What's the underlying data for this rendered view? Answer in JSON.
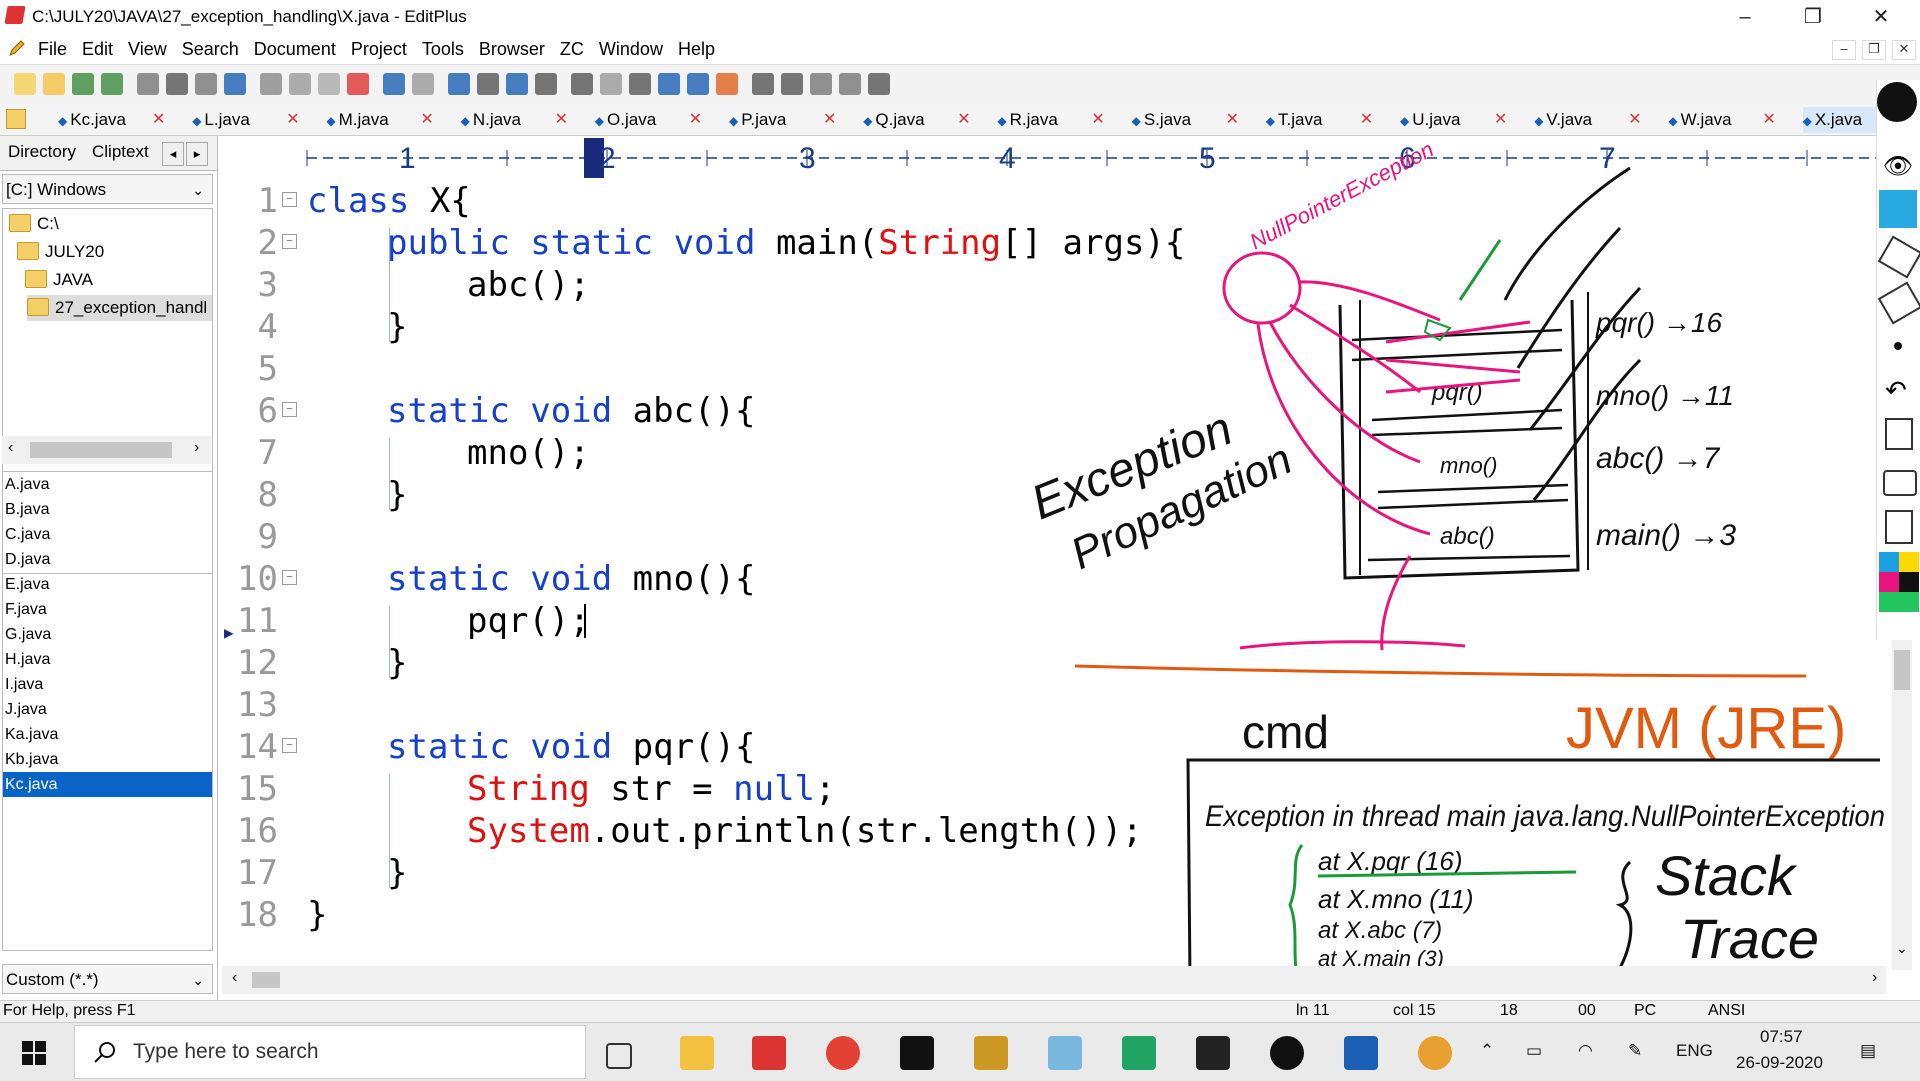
{
  "window": {
    "title": "C:\\JULY20\\JAVA\\27_exception_handling\\X.java - EditPlus",
    "controls": [
      "–",
      "❐",
      "✕"
    ]
  },
  "menubar": {
    "items": [
      "File",
      "Edit",
      "View",
      "Search",
      "Document",
      "Project",
      "Tools",
      "Browser",
      "ZC",
      "Window",
      "Help"
    ]
  },
  "tabs": [
    "Kc.java",
    "L.java",
    "M.java",
    "N.java",
    "O.java",
    "P.java",
    "Q.java",
    "R.java",
    "S.java",
    "T.java",
    "U.java",
    "V.java",
    "W.java",
    "X.java"
  ],
  "active_tab": "X.java",
  "left_panel": {
    "tabs": [
      "Directory",
      "Cliptext"
    ],
    "drive": "[C:] Windows",
    "tree": [
      "C:\\",
      "JULY20",
      "JAVA",
      "27_exception_handl"
    ],
    "files": [
      "A.java",
      "B.java",
      "C.java",
      "D.java",
      "E.java",
      "F.java",
      "G.java",
      "H.java",
      "I.java",
      "J.java",
      "Ka.java",
      "Kb.java",
      "Kc.java"
    ],
    "selected_file": "Kc.java",
    "filter": "Custom (*.*)"
  },
  "ruler": {
    "numbers": [
      "1",
      "2",
      "3",
      "4",
      "5",
      "6",
      "7"
    ]
  },
  "code": {
    "current_line": 11,
    "lines": [
      {
        "n": "1",
        "indent": 0,
        "tokens": [
          {
            "t": "class",
            "c": "kw"
          },
          {
            "t": " X{",
            "c": ""
          }
        ],
        "fold": true
      },
      {
        "n": "2",
        "indent": 1,
        "tokens": [
          {
            "t": "public static void",
            "c": "kw"
          },
          {
            "t": " main(",
            "c": ""
          },
          {
            "t": "String",
            "c": "red"
          },
          {
            "t": "[] args){",
            "c": ""
          }
        ],
        "fold": true
      },
      {
        "n": "3",
        "indent": 2,
        "tokens": [
          {
            "t": "abc();",
            "c": ""
          }
        ]
      },
      {
        "n": "4",
        "indent": 1,
        "tokens": [
          {
            "t": "}",
            "c": ""
          }
        ]
      },
      {
        "n": "5",
        "indent": 0,
        "tokens": []
      },
      {
        "n": "6",
        "indent": 1,
        "tokens": [
          {
            "t": "static void",
            "c": "kw"
          },
          {
            "t": " abc(){",
            "c": ""
          }
        ],
        "fold": true
      },
      {
        "n": "7",
        "indent": 2,
        "tokens": [
          {
            "t": "mno();",
            "c": ""
          }
        ]
      },
      {
        "n": "8",
        "indent": 1,
        "tokens": [
          {
            "t": "}",
            "c": ""
          }
        ]
      },
      {
        "n": "9",
        "indent": 0,
        "tokens": []
      },
      {
        "n": "10",
        "indent": 1,
        "tokens": [
          {
            "t": "static void",
            "c": "kw"
          },
          {
            "t": " mno(){",
            "c": ""
          }
        ],
        "fold": true
      },
      {
        "n": "11",
        "indent": 2,
        "tokens": [
          {
            "t": "pqr();",
            "c": ""
          }
        ]
      },
      {
        "n": "12",
        "indent": 1,
        "tokens": [
          {
            "t": "}",
            "c": ""
          }
        ]
      },
      {
        "n": "13",
        "indent": 0,
        "tokens": []
      },
      {
        "n": "14",
        "indent": 1,
        "tokens": [
          {
            "t": "static void",
            "c": "kw"
          },
          {
            "t": " pqr(){",
            "c": ""
          }
        ],
        "fold": true
      },
      {
        "n": "15",
        "indent": 2,
        "tokens": [
          {
            "t": "String",
            "c": "red"
          },
          {
            "t": " str = ",
            "c": ""
          },
          {
            "t": "null",
            "c": "kw"
          },
          {
            "t": ";",
            "c": ""
          }
        ]
      },
      {
        "n": "16",
        "indent": 2,
        "tokens": [
          {
            "t": "System",
            "c": "red"
          },
          {
            "t": ".out.println(str.length());",
            "c": ""
          }
        ]
      },
      {
        "n": "17",
        "indent": 1,
        "tokens": [
          {
            "t": "}",
            "c": ""
          }
        ]
      },
      {
        "n": "18",
        "indent": 0,
        "tokens": [
          {
            "t": "}",
            "c": ""
          }
        ]
      }
    ]
  },
  "annotations": {
    "npe_label": "NullPointerException",
    "stack_frames": [
      "pqr()",
      "mno()",
      "abc()"
    ],
    "side_labels": [
      "pqr() →16",
      "mno() →11",
      "abc() →7",
      "main() →3"
    ],
    "propagation_1": "Exception",
    "propagation_2": "Propagation",
    "cmd": "cmd",
    "jvm": "JVM (JRE)",
    "exception_line": "Exception in thread main java.lang.NullPointerException",
    "trace": [
      "at X.pqr (16)",
      "at X.mno (11)",
      "at X.abc (7)",
      "at X.main (3)"
    ],
    "stack_trace_1": "Stack",
    "stack_trace_2": "Trace"
  },
  "status": {
    "help": "For Help, press F1",
    "ln": "ln 11",
    "col": "col 15",
    "n1": "18",
    "n2": "00",
    "mode": "PC",
    "enc": "ANSI"
  },
  "taskbar": {
    "search_placeholder": "Type here to search",
    "lang": "ENG",
    "time": "07:57",
    "date": "26-09-2020"
  },
  "colors": {
    "keyword": "#1640c8",
    "type": "#e01010",
    "ink_pink": "#e8157f",
    "ink_black": "#111111",
    "ink_orange": "#e05a10",
    "ink_green": "#1c9a3a",
    "selection": "#0a64c8"
  }
}
